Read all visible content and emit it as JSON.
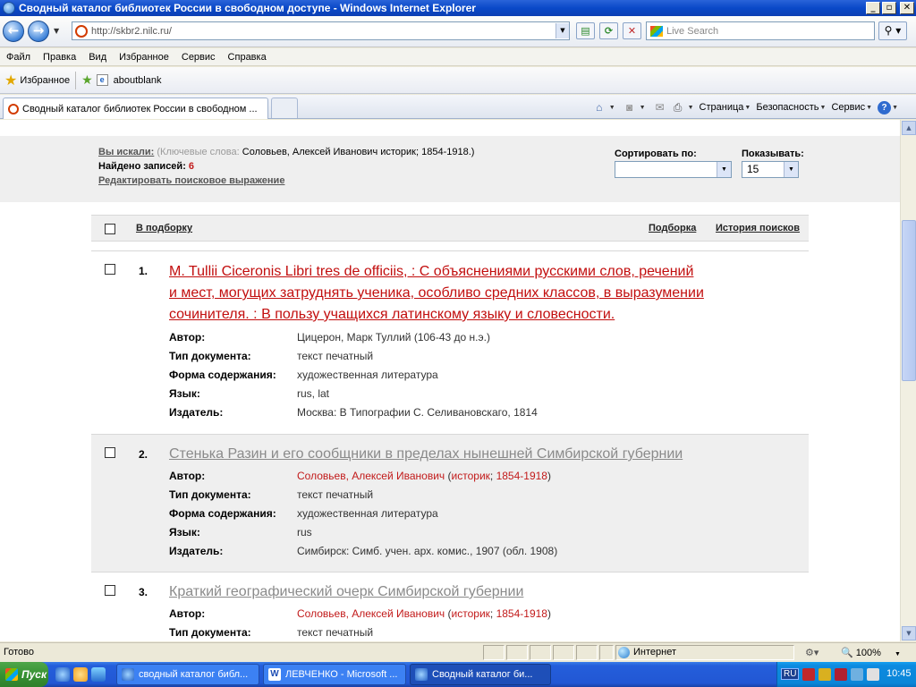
{
  "window": {
    "title": "Сводный каталог библиотек России в свободном доступе - Windows Internet Explorer",
    "minimize": "_",
    "maximize": "▫",
    "close": "✕"
  },
  "address": {
    "url": "http://skbr2.nilc.ru/",
    "search_placeholder": "Live Search"
  },
  "menu": [
    "Файл",
    "Правка",
    "Вид",
    "Избранное",
    "Сервис",
    "Справка"
  ],
  "favorites": {
    "label": "Избранное",
    "items": [
      "aboutblank"
    ]
  },
  "tab": {
    "title": "Сводный каталог библиотек России в свободном ..."
  },
  "commandbar": {
    "page": "Страница",
    "safety": "Безопасность",
    "tools": "Сервис"
  },
  "search_info": {
    "you_searched_label": "Вы искали:",
    "keywords_label": "(Ключевые слова:",
    "keywords_value": "Соловьев, Алексей Иванович историк; 1854-1918.)",
    "found_label": "Найдено записей:",
    "found_count": "6",
    "edit_link": "Редактировать поисковое выражение",
    "sort_label": "Сортировать по:",
    "sort_value": "",
    "show_label": "Показывать:",
    "show_value": "15"
  },
  "toolbar": {
    "add_to_selection": "В подборку",
    "selection": "Подборка",
    "history": "История поисков"
  },
  "records": [
    {
      "num": "1.",
      "title_lines": [
        "M. Tullii Ciceronis Libri tres de officiis, : С объяснениями русскими слов, речений",
        "и мест, могущих затруднять ученика, особливо средних классов, в выразумении",
        "сочинителя. : В пользу учащихся латинскому языку и словесности."
      ],
      "fields": [
        {
          "label": "Автор:",
          "value": "Цицерон, Марк Туллий (106-43 до н.э.)"
        },
        {
          "label": "Тип документа:",
          "value": "текст печатный"
        },
        {
          "label": "Форма содержания:",
          "value": "художественная литература"
        },
        {
          "label": "Язык:",
          "value": "rus, lat"
        },
        {
          "label": "Издатель:",
          "value": "Москва: В Типографии С. Селивановскаго, 1814"
        }
      ]
    },
    {
      "num": "2.",
      "title_lines": [
        "Стенька Разин и его сообщники в пределах нынешней Симбирской губернии"
      ],
      "author": {
        "name": "Соловьев, Алексей Иванович",
        "role": "историк",
        "dates": "1854-1918"
      },
      "fields": [
        {
          "label": "Автор:",
          "value": ""
        },
        {
          "label": "Тип документа:",
          "value": "текст печатный"
        },
        {
          "label": "Форма содержания:",
          "value": "художественная литература"
        },
        {
          "label": "Язык:",
          "value": "rus"
        },
        {
          "label": "Издатель:",
          "value": "Симбирск: Симб. учен. арх. комис., 1907 (обл. 1908)"
        }
      ]
    },
    {
      "num": "3.",
      "title_lines": [
        "Краткий географический очерк Симбирской губернии"
      ],
      "author": {
        "name": "Соловьев, Алексей Иванович",
        "role": "историк",
        "dates": "1854-1918"
      },
      "fields": [
        {
          "label": "Автор:",
          "value": ""
        },
        {
          "label": "Тип документа:",
          "value": "текст печатный"
        }
      ]
    }
  ],
  "status": {
    "text": "Готово",
    "zone": "Интернет",
    "zoom": "100%"
  },
  "taskbar": {
    "start": "Пуск",
    "tasks": [
      "сводный каталог библ...",
      "ЛЕВЧЕНКО - Microsoft ...",
      "Сводный каталог би..."
    ],
    "lang": "RU",
    "clock": "10:45"
  }
}
